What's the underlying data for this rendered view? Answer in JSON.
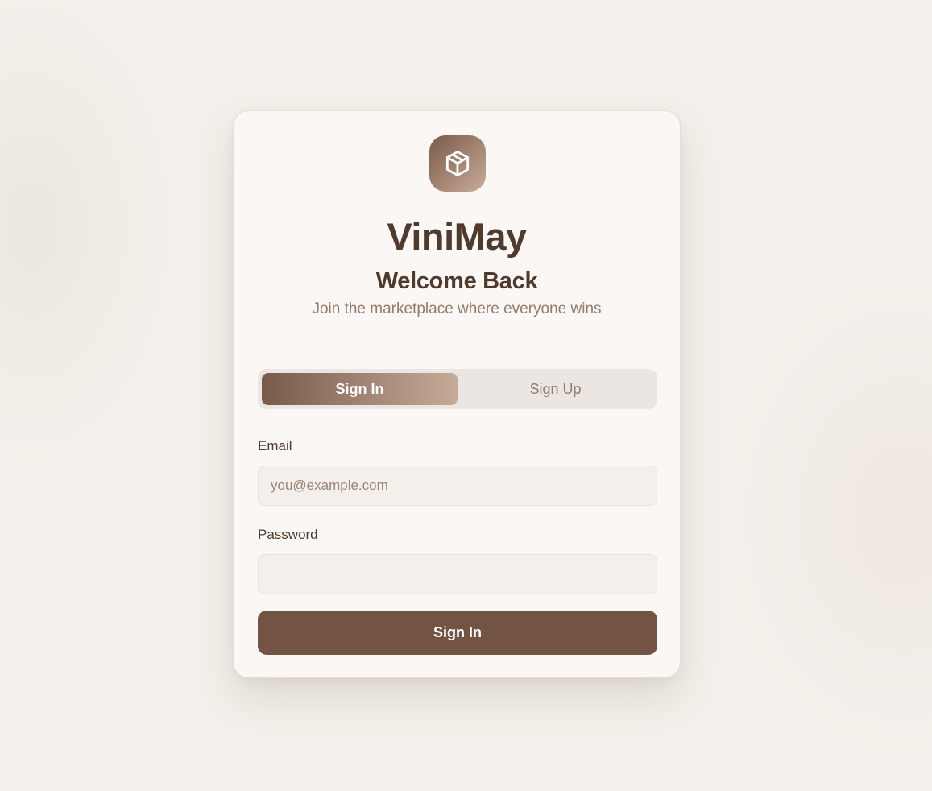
{
  "brand": {
    "name": "ViniMay",
    "logo_icon": "package-box-icon"
  },
  "auth": {
    "heading": "Welcome Back",
    "subtitle": "Join the marketplace where everyone wins",
    "tabs": [
      {
        "label": "Sign In",
        "active": true
      },
      {
        "label": "Sign Up",
        "active": false
      }
    ],
    "email": {
      "label": "Email",
      "placeholder": "you@example.com",
      "value": ""
    },
    "password": {
      "label": "Password",
      "placeholder": "",
      "value": ""
    },
    "submit_label": "Sign In"
  },
  "colors": {
    "background": "#f3f0eb",
    "card": "#faf7f4",
    "primary": "#735444",
    "text_dark": "#4f3a2d",
    "text_muted": "#937b6c",
    "gradient_start": "#785a4a",
    "gradient_end": "#c7ab99"
  }
}
